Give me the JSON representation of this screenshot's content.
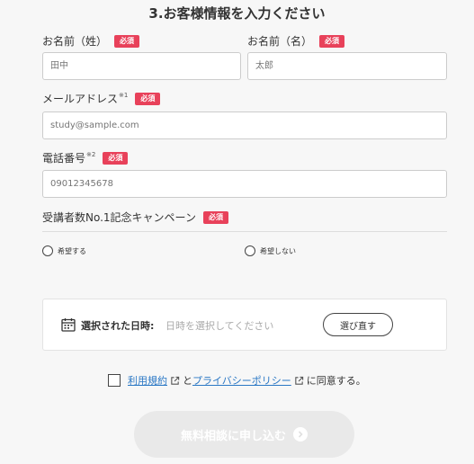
{
  "section": {
    "title": "3.お客様情報を入力ください"
  },
  "required_badge": "必須",
  "fields": {
    "last_name": {
      "label": "お名前（姓）",
      "placeholder": "田中"
    },
    "first_name": {
      "label": "お名前（名）",
      "placeholder": "太郎"
    },
    "email": {
      "label": "メールアドレス",
      "note": "※1",
      "placeholder": "study@sample.com"
    },
    "phone": {
      "label": "電話番号",
      "note": "※2",
      "placeholder": "09012345678"
    }
  },
  "campaign": {
    "label": "受講者数No.1記念キャンペーン",
    "options": [
      "希望する",
      "希望しない"
    ]
  },
  "date_selection": {
    "label": "選択された日時:",
    "value": "日時を選択してください",
    "reselect_label": "選び直す"
  },
  "agreement": {
    "terms_link": "利用規約",
    "connector": "と",
    "privacy_link": "プライバシーポリシー",
    "suffix": "に同意する。"
  },
  "submit": {
    "label": "無料相談に申し込む"
  },
  "colors": {
    "accent_badge": "#e8415a",
    "link": "#2b78c5",
    "submit_disabled": "#e9e9e9",
    "background": "#f7f7f7"
  },
  "icons": [
    "calendar-icon",
    "external-link-icon",
    "arrow-right-icon"
  ]
}
